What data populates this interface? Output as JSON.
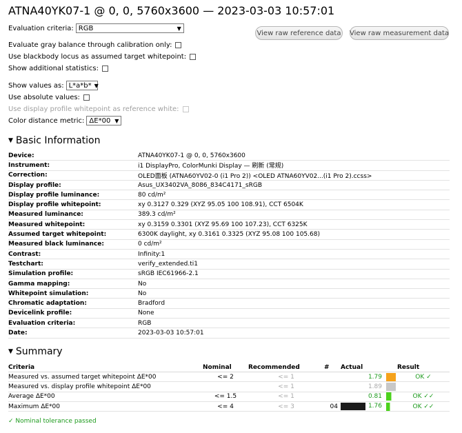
{
  "title": "ATNA40YK07-1 @ 0, 0, 5760x3600 — 2023-03-03 10:57:01",
  "controls": {
    "evaluation_criteria_label": "Evaluation criteria:",
    "evaluation_criteria_value": "RGB",
    "gray_balance_label": "Evaluate gray balance through calibration only:",
    "blackbody_label": "Use blackbody locus as assumed target whitepoint:",
    "additional_stats_label": "Show additional statistics:",
    "show_values_label": "Show values as:",
    "show_values_value": "L*a*b*",
    "absolute_values_label": "Use absolute values:",
    "display_profile_whitepoint_label": "Use display profile whitepoint as reference white:",
    "color_distance_label": "Color distance metric:",
    "color_distance_value": "ΔE*00"
  },
  "buttons": {
    "view_reference": "View raw reference data",
    "view_measurement": "View raw measurement data"
  },
  "basic_info": {
    "heading": "Basic Information",
    "rows": [
      {
        "k": "Device:",
        "v": "ATNA40YK07-1 @ 0, 0, 5760x3600"
      },
      {
        "k": "Instrument:",
        "v": "i1 DisplayPro, ColorMunki Display — 刷新 (常规)"
      },
      {
        "k": "Correction:",
        "v": "OLED面板 (ATNA60YV02-0 (i1 Pro 2)) <OLED ATNA60YV02...(i1 Pro 2).ccss>"
      },
      {
        "k": "Display profile:",
        "v": "Asus_UX3402VA_8086_834C4171_sRGB"
      },
      {
        "k": "Display profile luminance:",
        "v": "80 cd/m²"
      },
      {
        "k": "Display profile whitepoint:",
        "v": "xy 0.3127 0.329 (XYZ 95.05 100 108.91), CCT 6504K"
      },
      {
        "k": "Measured luminance:",
        "v": "389.3 cd/m²"
      },
      {
        "k": "Measured whitepoint:",
        "v": "xy 0.3159 0.3301 (XYZ 95.69 100 107.23), CCT 6325K"
      },
      {
        "k": "Assumed target whitepoint:",
        "v": "6300K daylight, xy 0.3161 0.3325 (XYZ 95.08 100 105.68)"
      },
      {
        "k": "Measured black luminance:",
        "v": "0 cd/m²"
      },
      {
        "k": "Contrast:",
        "v": "Infinity:1"
      },
      {
        "k": "Testchart:",
        "v": "verify_extended.ti1"
      },
      {
        "k": "Simulation profile:",
        "v": "sRGB IEC61966-2.1"
      },
      {
        "k": "Gamma mapping:",
        "v": "No"
      },
      {
        "k": "Whitepoint simulation:",
        "v": "No"
      },
      {
        "k": "Chromatic adaptation:",
        "v": "Bradford"
      },
      {
        "k": "Devicelink profile:",
        "v": "None"
      },
      {
        "k": "Evaluation criteria:",
        "v": "RGB"
      },
      {
        "k": "Date:",
        "v": "2023-03-03 10:57:01"
      }
    ]
  },
  "summary": {
    "heading": "Summary",
    "headers": {
      "criteria": "Criteria",
      "nominal": "Nominal",
      "recommended": "Recommended",
      "number": "#",
      "actual": "Actual",
      "result": "Result"
    },
    "rows": [
      {
        "criteria": "Measured vs. assumed target whitepoint ΔE*00",
        "nominal": "<= 2",
        "recommended": "<= 1",
        "number": "",
        "actual": "1.79",
        "swatch": "#f5a21b",
        "swatch_level": 1.0,
        "result": "OK ✓"
      },
      {
        "criteria": "Measured vs. display profile whitepoint ΔE*00",
        "nominal": "",
        "recommended": "<= 1",
        "number": "",
        "actual": "1.89",
        "swatch": "#c8c8c8",
        "swatch_level": 1.0,
        "result": ""
      },
      {
        "criteria": "Average ΔE*00",
        "nominal": "<= 1.5",
        "recommended": "<= 1",
        "number": "",
        "actual": "0.81",
        "swatch": "#4cd21c",
        "swatch_level": 0.55,
        "result": "OK ✓✓"
      },
      {
        "criteria": "Maximum ΔE*00",
        "nominal": "<= 4",
        "recommended": "<= 3",
        "number": "04",
        "actual": "1.76",
        "swatch": "#4cd21c",
        "swatch_level": 0.4,
        "result": "OK ✓✓"
      }
    ],
    "footer": "✓ Nominal tolerance passed"
  }
}
